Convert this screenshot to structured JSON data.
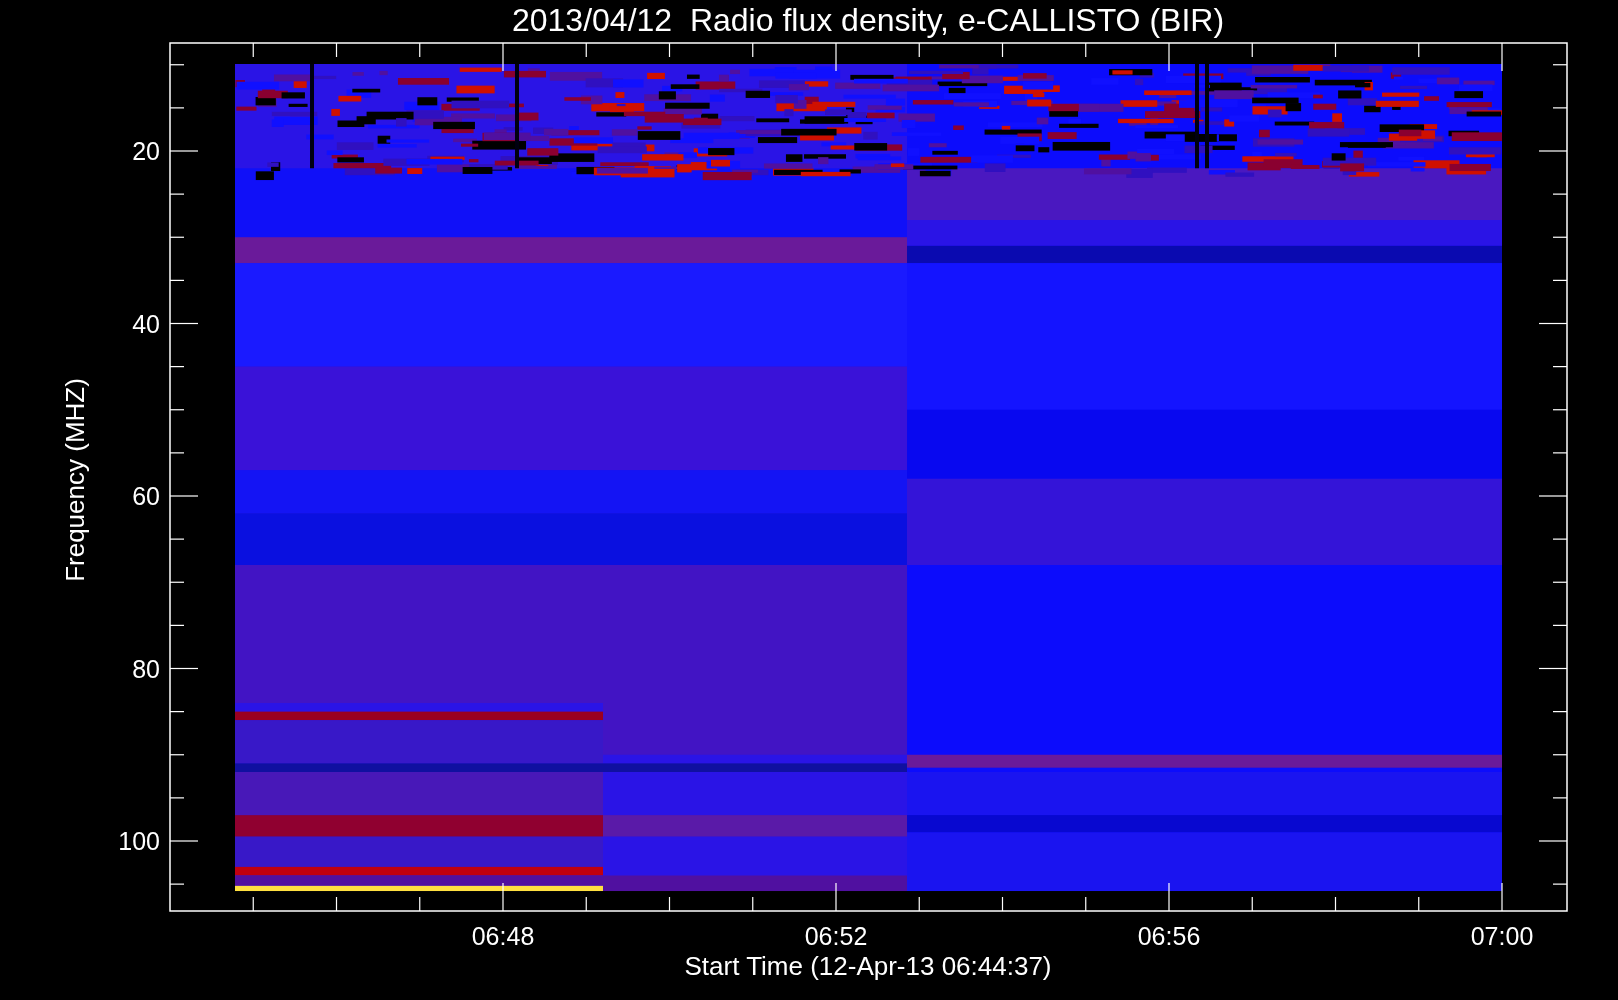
{
  "title": "2013/04/12  Radio flux density, e-CALLISTO (BIR)",
  "y_axis": {
    "label": "Frequency (MHZ)",
    "ticks": [
      "20",
      "40",
      "60",
      "80",
      "100"
    ]
  },
  "x_axis": {
    "label": "Start Time (12-Apr-13 06:44:37)",
    "ticks": [
      "06:48",
      "06:52",
      "06:56",
      "07:00"
    ]
  }
}
